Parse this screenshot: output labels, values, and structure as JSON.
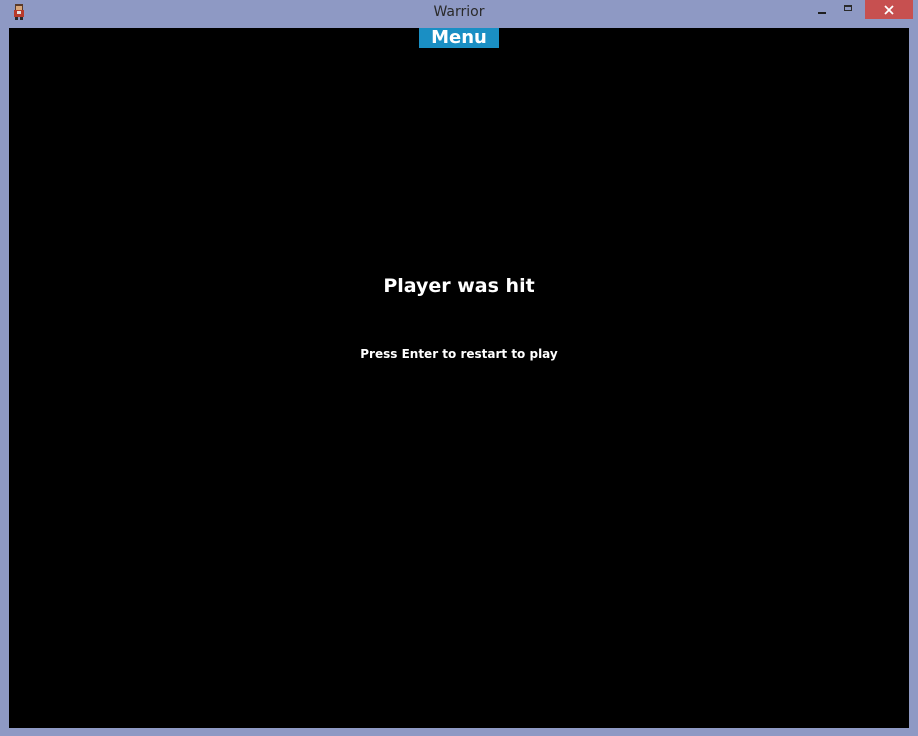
{
  "window": {
    "title": "Warrior",
    "icon": "warrior-app-icon",
    "controls": {
      "minimize_icon": "minimize-icon",
      "maximize_icon": "maximize-icon",
      "close_icon": "close-icon",
      "close_color": "#c75050"
    },
    "frame_color": "#8e99c4"
  },
  "game": {
    "background": "#000000",
    "menu_button_label": "Menu",
    "menu_button_color": "#1a8fc4",
    "status_message": "Player was hit",
    "instruction": "Press Enter to restart to play"
  }
}
